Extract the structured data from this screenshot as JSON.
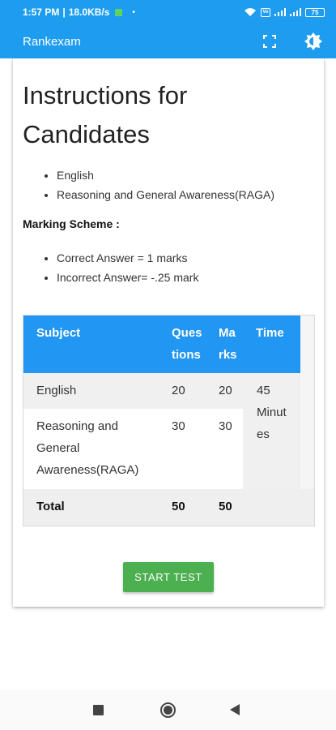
{
  "status_bar": {
    "time": "1:57 PM",
    "speed": "18.0KB/s",
    "dot": "•",
    "battery": "75"
  },
  "app_bar": {
    "title": "Rankexam",
    "icons": [
      "fullscreen-icon",
      "brightness-icon"
    ]
  },
  "instructions": {
    "title": "Instructions for Candidates",
    "subjects": [
      "English",
      "Reasoning and General Awareness(RAGA)"
    ],
    "marking_label": "Marking Scheme :",
    "marking_items": [
      "Correct Answer = 1 marks",
      "Incorrect Answer= -.25 mark"
    ]
  },
  "table": {
    "headers": {
      "subject": "Subject",
      "questions_line1": "Ques",
      "questions_line2": "tions",
      "marks_line1": "Ma",
      "marks_line2": "rks",
      "time": "Time"
    },
    "rows": [
      {
        "subject": "English",
        "questions": "20",
        "marks": "20"
      },
      {
        "subject_line1": "Reasoning and",
        "subject_line2": "General",
        "subject_line3": "Awareness(RAGA)",
        "questions": "30",
        "marks": "30"
      }
    ],
    "time_line1": "45",
    "time_line2": "Minut",
    "time_line3": "es",
    "total": {
      "label": "Total",
      "questions": "50",
      "marks": "50"
    }
  },
  "start_button": "START TEST",
  "nav_bar": {
    "icons": [
      "recent-apps-icon",
      "home-icon",
      "back-icon"
    ]
  },
  "colors": {
    "primary": "#1e9df0",
    "table_header": "#2196f3",
    "button": "#4caf50"
  }
}
